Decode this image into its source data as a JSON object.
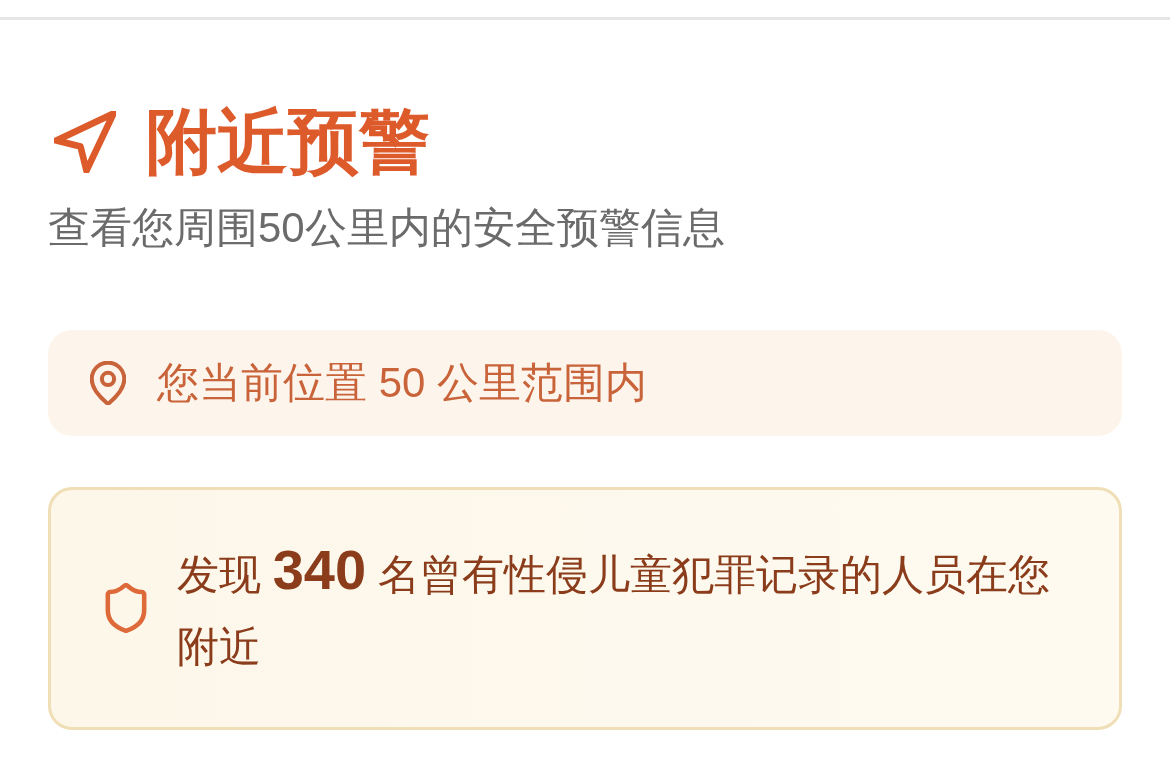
{
  "header": {
    "title": "附近预警",
    "subtitle": "查看您周围50公里内的安全预警信息"
  },
  "location_banner": {
    "text": "您当前位置 50 公里范围内"
  },
  "alert": {
    "text": "发现 **340** 名曾有性侵儿童犯罪记录的人员在您附近"
  }
}
